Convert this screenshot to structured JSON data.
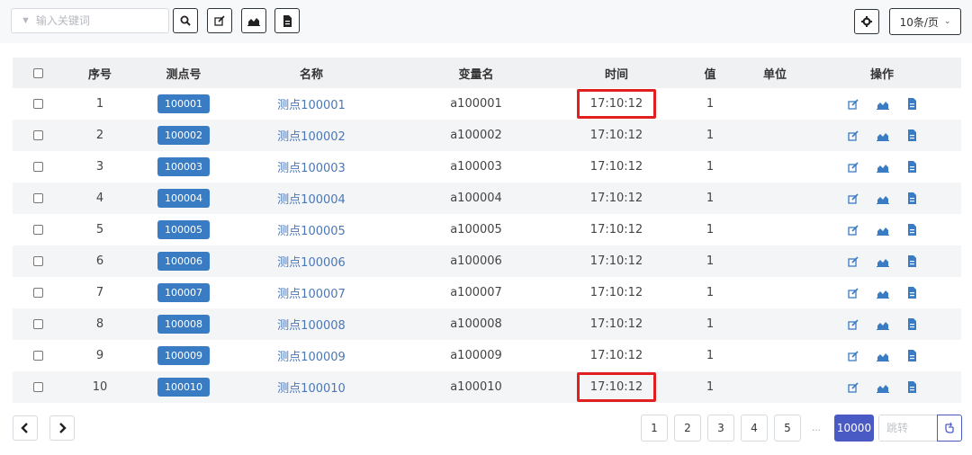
{
  "toolbar": {
    "search_placeholder": "输入关键词",
    "page_size": "10条/页"
  },
  "table": {
    "headers": [
      "序号",
      "测点号",
      "名称",
      "变量名",
      "时间",
      "值",
      "单位",
      "操作"
    ],
    "rows": [
      {
        "index": "1",
        "point": "100001",
        "name": "测点100001",
        "var": "a100001",
        "time": "17:10:12",
        "value": "1",
        "unit": "",
        "highlighted": true
      },
      {
        "index": "2",
        "point": "100002",
        "name": "测点100002",
        "var": "a100002",
        "time": "17:10:12",
        "value": "1",
        "unit": ""
      },
      {
        "index": "3",
        "point": "100003",
        "name": "测点100003",
        "var": "a100003",
        "time": "17:10:12",
        "value": "1",
        "unit": ""
      },
      {
        "index": "4",
        "point": "100004",
        "name": "测点100004",
        "var": "a100004",
        "time": "17:10:12",
        "value": "1",
        "unit": ""
      },
      {
        "index": "5",
        "point": "100005",
        "name": "测点100005",
        "var": "a100005",
        "time": "17:10:12",
        "value": "1",
        "unit": ""
      },
      {
        "index": "6",
        "point": "100006",
        "name": "测点100006",
        "var": "a100006",
        "time": "17:10:12",
        "value": "1",
        "unit": ""
      },
      {
        "index": "7",
        "point": "100007",
        "name": "测点100007",
        "var": "a100007",
        "time": "17:10:12",
        "value": "1",
        "unit": ""
      },
      {
        "index": "8",
        "point": "100008",
        "name": "测点100008",
        "var": "a100008",
        "time": "17:10:12",
        "value": "1",
        "unit": ""
      },
      {
        "index": "9",
        "point": "100009",
        "name": "测点100009",
        "var": "a100009",
        "time": "17:10:12",
        "value": "1",
        "unit": ""
      },
      {
        "index": "10",
        "point": "100010",
        "name": "测点100010",
        "var": "a100010",
        "time": "17:10:12",
        "value": "1",
        "unit": "",
        "highlighted": true
      }
    ]
  },
  "pagination": {
    "pages": [
      "1",
      "2",
      "3",
      "4",
      "5"
    ],
    "ellipsis": "...",
    "last_page": "10000",
    "jump_placeholder": "跳转"
  },
  "colors": {
    "tag": "#3a7cc4",
    "link": "#4a77b8",
    "active_page": "#4a5ac4",
    "highlight": "#e02020"
  }
}
